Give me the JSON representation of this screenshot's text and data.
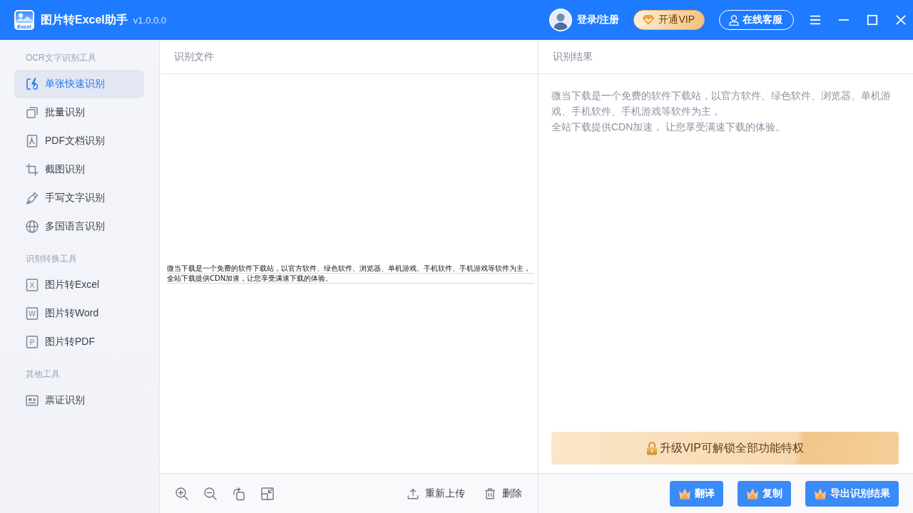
{
  "window": {
    "logo_text": "Excel",
    "title": "图片转Excel助手",
    "version": "v1.0.0.0",
    "controls": [
      {
        "kind": "menu"
      },
      {
        "kind": "minimize"
      },
      {
        "kind": "maximize"
      },
      {
        "kind": "close"
      }
    ]
  },
  "account": {
    "login": "登录/注册",
    "vip_button": "开通VIP",
    "service_button": "在线客服"
  },
  "sidebar": {
    "sections": [
      {
        "heading": "OCR文字识别工具",
        "items": [
          {
            "kind": "quick",
            "label": "单张快速识别",
            "selected": true
          },
          {
            "kind": "batch",
            "label": "批量识别",
            "selected": false
          },
          {
            "kind": "pdf",
            "label": "PDF文档识别",
            "selected": false
          },
          {
            "kind": "crop",
            "label": "截图识别",
            "selected": false
          },
          {
            "kind": "pen",
            "label": "手写文字识别",
            "selected": false
          },
          {
            "kind": "globe",
            "label": "多国语言识别",
            "selected": false
          }
        ]
      },
      {
        "heading": "识别转换工具",
        "items": [
          {
            "kind": "letter",
            "icon_letter": "X",
            "label": "图片转Excel",
            "selected": false
          },
          {
            "kind": "letter",
            "icon_letter": "W",
            "label": "图片转Word",
            "selected": false
          },
          {
            "kind": "letter",
            "icon_letter": "P",
            "label": "图片转PDF",
            "selected": false
          }
        ]
      },
      {
        "heading": "其他工具",
        "items": [
          {
            "kind": "ticket",
            "label": "票证识别",
            "selected": false
          }
        ]
      }
    ]
  },
  "file_panel": {
    "title": "识别文件",
    "image_lines": [
      "微当下载是一个免费的软件下载站，以官方软件、绿色软件、浏览器、单机游戏、手机软件、手机游戏等软件为主，",
      "全站下载提供CDN加速，让您享受满速下载的体验。"
    ],
    "tools": [
      {
        "kind": "zoom-in"
      },
      {
        "kind": "zoom-out"
      },
      {
        "kind": "rotate"
      },
      {
        "kind": "fit"
      }
    ],
    "actions": [
      {
        "kind": "upload",
        "label": "重新上传"
      },
      {
        "kind": "delete",
        "label": "删除"
      }
    ]
  },
  "result_panel": {
    "title": "识别结果",
    "paragraphs": [
      "微当下载是一个免费的软件下载站，以官方软件、绿色软件、浏览器、单机游戏、手机软件、手机游戏等软件为主，",
      "全站下载提供CDN加速， 让您享受满速下载的体验。"
    ],
    "banner": "升级VIP可解锁全部功能特权",
    "buttons": [
      {
        "label": "翻译"
      },
      {
        "label": "复制"
      },
      {
        "label": "导出识别结果"
      }
    ]
  }
}
